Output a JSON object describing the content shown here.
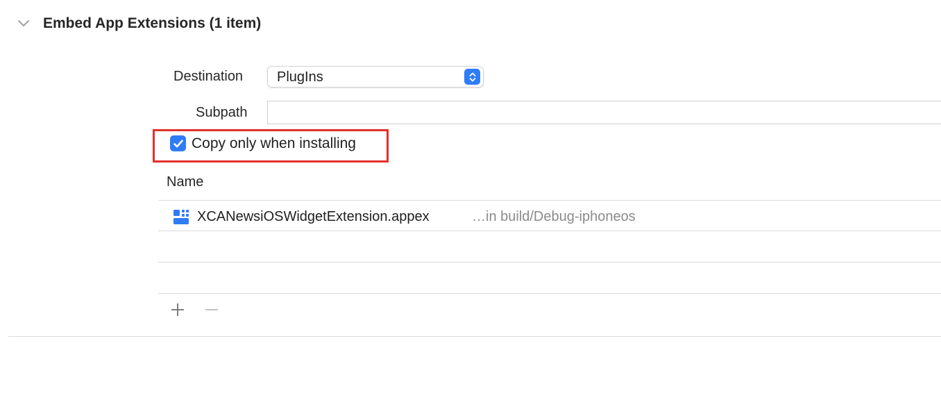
{
  "section": {
    "title": "Embed App Extensions (1 item)",
    "disclosure_icon": "chevron-down-icon"
  },
  "destination": {
    "label": "Destination",
    "selected": "PlugIns",
    "stepper_icon": "up-down-chevron-icon"
  },
  "subpath": {
    "label": "Subpath",
    "value": ""
  },
  "copy_option": {
    "label": "Copy only when installing",
    "checked": true,
    "highlight_color": "#e3302c"
  },
  "table": {
    "column_header": "Name",
    "rows": [
      {
        "icon": "app-extension-icon",
        "name": "XCANewsiOSWidgetExtension.appex",
        "location": "…in build/Debug-iphoneos"
      }
    ]
  },
  "toolbar": {
    "add_icon": "plus-icon",
    "remove_icon": "minus-icon"
  },
  "colors": {
    "accent": "#2f7cf6",
    "separator": "#dcdcdc",
    "secondary_text": "#8a8a8a"
  }
}
